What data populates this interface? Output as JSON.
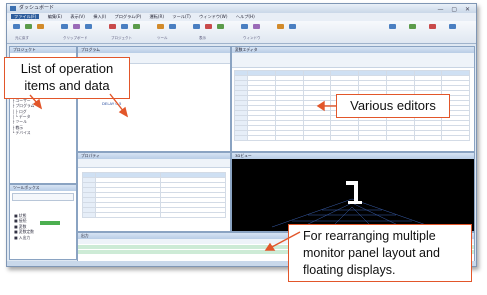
{
  "window": {
    "title": "ダッシュボード",
    "buttons": "— ▢ ✕"
  },
  "menu": [
    "ファイル(F)",
    "編集(E)",
    "表示(V)",
    "挿入(I)",
    "プログラム(P)",
    "運転(R)",
    "ツール(T)",
    "ウィンドウ(W)",
    "ヘルプ(H)"
  ],
  "ribbon": {
    "groups": [
      "元に戻す",
      "クリップボード",
      "プロジェクト",
      "ツール",
      "表示",
      "ウィンドウ"
    ]
  },
  "panels": {
    "tree_header": "プロジェクト",
    "tree_items": [
      "□ プロジェクト",
      "├ プログラム",
      "├ ユーザー",
      "├ プログラム",
      "│ ├ ログ",
      "│ └ データ",
      "├ ツール",
      "├ 教示",
      "└ デバイス"
    ],
    "program_header": "プログラム",
    "program_lines": [
      "MOVE P1",
      "MOVE P2",
      "SPEED 50",
      "DELAY 0.5"
    ],
    "editor_header": "変数エディタ",
    "view3d_header": "3Dビュー",
    "property_header": "プロパティ",
    "output_header": "出力",
    "toolbox_header": "ツールボックス",
    "toolbox_items": [
      "■ 状態",
      "■ 接続",
      "■ 変数",
      "■ 変数定数",
      "■ 入出力"
    ]
  },
  "callouts": {
    "list": "List of operation items and data",
    "editors": "Various editors",
    "monitor": "For rearranging multiple monitor panel layout and floating displays."
  },
  "colors": {
    "callout_border": "#e2562a",
    "accent": "#2f5f9e"
  }
}
